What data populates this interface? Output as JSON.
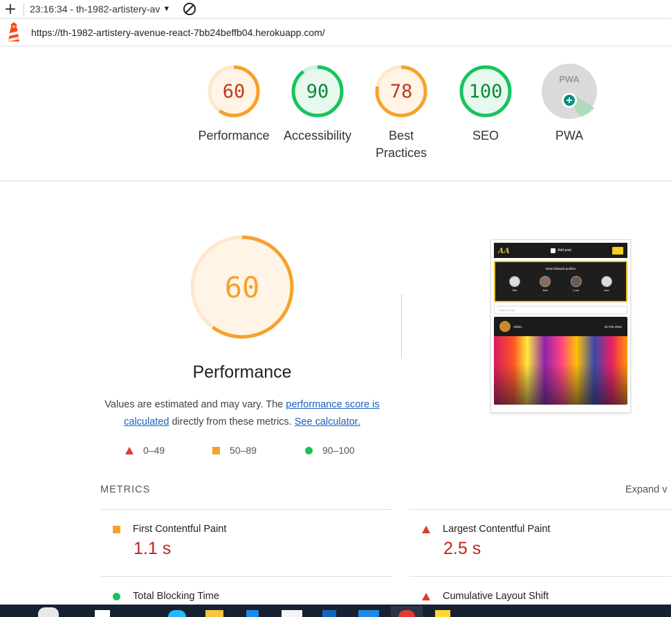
{
  "toolbar": {
    "new_tab_label": "+",
    "session": "23:16:34 - th-1982-artistery-av",
    "caret": "▼"
  },
  "url": "https://th-1982-artistery-avenue-react-7bb24beffb04.herokuapp.com/",
  "gauges": [
    {
      "score": "60",
      "label": "Performance",
      "value": 60,
      "color": "#f6a22b",
      "text_color": "#c0391e"
    },
    {
      "score": "90",
      "label": "Accessibility",
      "value": 90,
      "color": "#17c35d",
      "text_color": "#0a8a36"
    },
    {
      "score": "78",
      "label": "Best Practices",
      "value": 78,
      "color": "#f6a22b",
      "text_color": "#c0391e"
    },
    {
      "score": "100",
      "label": "SEO",
      "value": 100,
      "color": "#17c35d",
      "text_color": "#0a8a36"
    },
    {
      "score": "",
      "label": "PWA",
      "value": null,
      "color": "#9e9e9e",
      "text_color": "#9e9e9e"
    }
  ],
  "pwa_badge_text": "PWA",
  "performance": {
    "score": "60",
    "value": 60,
    "title": "Performance",
    "desc_part1": "Values are estimated and may vary. The ",
    "link1": "performance score is calculated",
    "desc_part2": " directly from these metrics. ",
    "link2": "See calculator."
  },
  "legend": [
    {
      "shape": "triangle",
      "range": "0–49",
      "color": "#e03a2e"
    },
    {
      "shape": "square",
      "range": "50–89",
      "color": "#f6a22b"
    },
    {
      "shape": "circle",
      "range": "90–100",
      "color": "#17c35d"
    }
  ],
  "thumbnail": {
    "add_post": "Add post",
    "profiles_title": "Most followed profiles",
    "avatars": [
      "Mia",
      "felix",
      "Luca",
      "uwe"
    ],
    "search_placeholder": "Search posts",
    "post_user": "Admin",
    "post_date": "22 Feb 2024"
  },
  "metrics": {
    "label": "METRICS",
    "expand": "Expand v",
    "items": [
      {
        "name": "First Contentful Paint",
        "value": "1.1 s",
        "status": "average"
      },
      {
        "name": "Largest Contentful Paint",
        "value": "2.5 s",
        "status": "fail"
      },
      {
        "name": "Total Blocking Time",
        "value": "",
        "status": "pass"
      },
      {
        "name": "Cumulative Layout Shift",
        "value": "",
        "status": "fail"
      }
    ]
  }
}
